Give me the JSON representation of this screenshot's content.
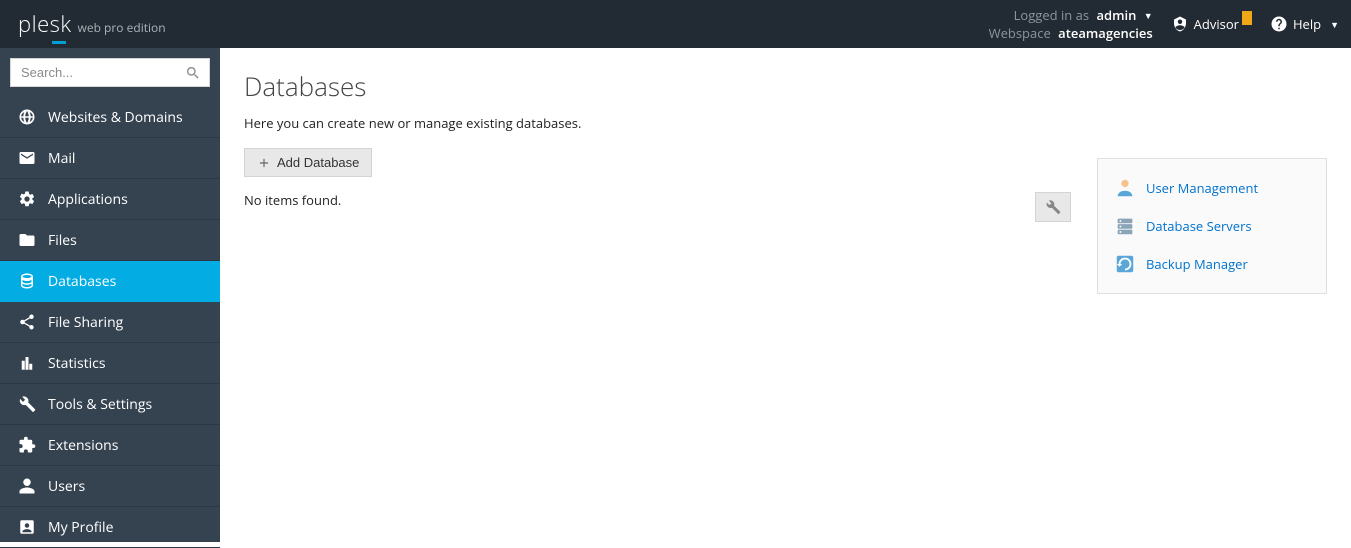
{
  "header": {
    "logo_main": "plesk",
    "logo_sub": "web pro edition",
    "logged_in_label": "Logged in as",
    "logged_in_user": "admin",
    "webspace_label": "Webspace",
    "webspace_value": "ateamagencies",
    "advisor_label": "Advisor",
    "help_label": "Help"
  },
  "search": {
    "placeholder": "Search..."
  },
  "sidebar": {
    "items": [
      {
        "label": "Websites & Domains"
      },
      {
        "label": "Mail"
      },
      {
        "label": "Applications"
      },
      {
        "label": "Files"
      },
      {
        "label": "Databases"
      },
      {
        "label": "File Sharing"
      },
      {
        "label": "Statistics"
      },
      {
        "label": "Tools & Settings"
      },
      {
        "label": "Extensions"
      },
      {
        "label": "Users"
      },
      {
        "label": "My Profile"
      }
    ]
  },
  "page": {
    "title": "Databases",
    "description": "Here you can create new or manage existing databases.",
    "add_button": "Add Database",
    "empty": "No items found."
  },
  "panel": {
    "items": [
      {
        "label": "User Management"
      },
      {
        "label": "Database Servers"
      },
      {
        "label": "Backup Manager"
      }
    ]
  }
}
